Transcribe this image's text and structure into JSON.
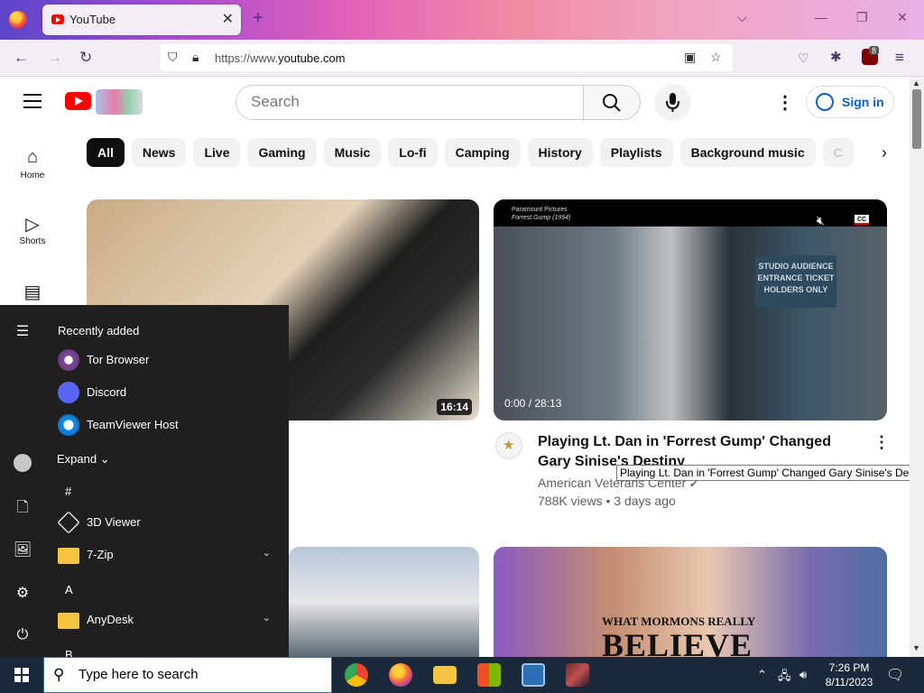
{
  "browser": {
    "tab_title": "YouTube",
    "url_prefix": "https://www.",
    "url_domain": "youtube.com",
    "extension_badge": "8"
  },
  "youtube": {
    "search_placeholder": "Search",
    "signin_label": "Sign in",
    "chips": [
      "All",
      "News",
      "Live",
      "Gaming",
      "Music",
      "Lo-fi",
      "Camping",
      "History",
      "Playlists",
      "Background music",
      "C"
    ],
    "guide": [
      {
        "label": "Home",
        "icon": "home-icon"
      },
      {
        "label": "Shorts",
        "icon": "shorts-icon"
      },
      {
        "label": "",
        "icon": "subscriptions-icon"
      }
    ],
    "video1": {
      "duration": "16:14"
    },
    "video2": {
      "player_line1": "Paramount Pictures",
      "player_line2": "Forrest Gump (1994)",
      "sign_text": "STUDIO AUDIENCE ENTRANCE TICKET HOLDERS ONLY",
      "cc": "CC",
      "time": "0:00 / 28:13",
      "title": "Playing Lt. Dan in 'Forrest Gump' Changed Gary Sinise's Destiny",
      "channel": "American Veterans Center",
      "meta": "788K views • 3 days ago",
      "tooltip": "Playing Lt. Dan in 'Forrest Gump' Changed Gary Sinise's Destiny"
    },
    "video4": {
      "line1": "WHAT MORMONS REALLY",
      "line2": "BELIEVE"
    }
  },
  "start_menu": {
    "recently_added": "Recently added",
    "recent_apps": [
      "Tor Browser",
      "Discord",
      "TeamViewer Host"
    ],
    "expand": "Expand",
    "letter_hash": "#",
    "apps_hash": [
      "3D Viewer",
      "7-Zip"
    ],
    "letter_a": "A",
    "apps_a": [
      "AnyDesk"
    ],
    "letter_b": "B"
  },
  "taskbar": {
    "search_placeholder": "Type here to search",
    "time": "7:26 PM",
    "date": "8/11/2023"
  }
}
